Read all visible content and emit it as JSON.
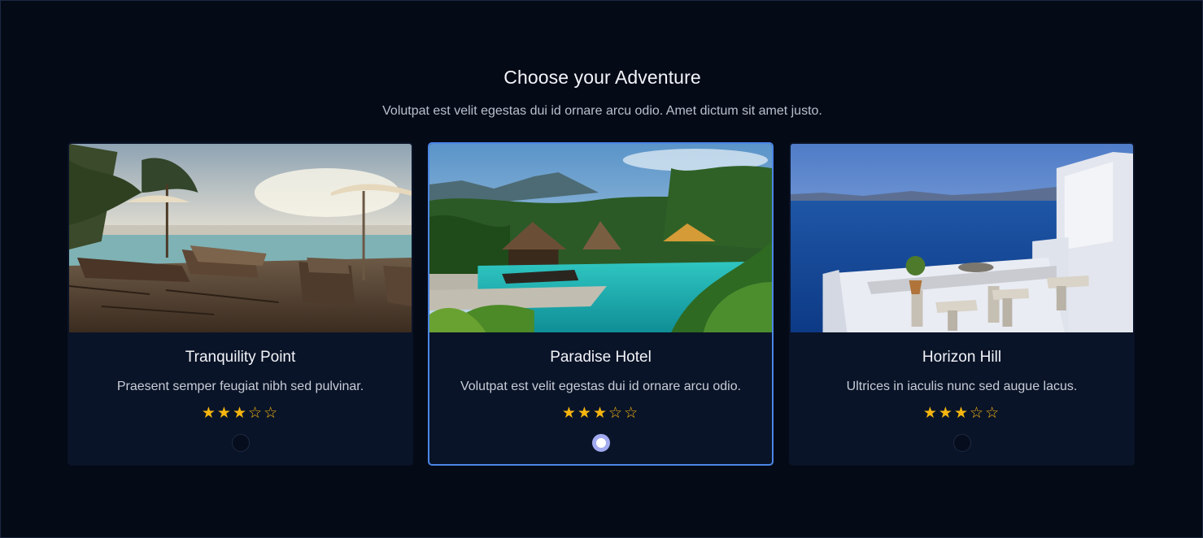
{
  "section": {
    "heading": "Choose your Adventure",
    "subheading": "Volutpat est velit egestas dui id ornare arcu odio. Amet dictum sit amet justo."
  },
  "cards": [
    {
      "title": "Tranquility Point",
      "description": "Praesent semper feugiat nibh sed pulvinar.",
      "rating": 3,
      "rating_max": 5,
      "selected": false
    },
    {
      "title": "Paradise Hotel",
      "description": "Volutpat est velit egestas dui id ornare arcu odio.",
      "rating": 3,
      "rating_max": 5,
      "selected": true
    },
    {
      "title": "Horizon Hill",
      "description": "Ultrices in iaculis nunc sed augue lacus.",
      "rating": 3,
      "rating_max": 5,
      "selected": false
    }
  ],
  "colors": {
    "background": "#050a17",
    "card": "#0a1428",
    "accent_border": "#4b86e6",
    "star": "#f6b60f",
    "radio_selected": "#a2aaf0"
  }
}
